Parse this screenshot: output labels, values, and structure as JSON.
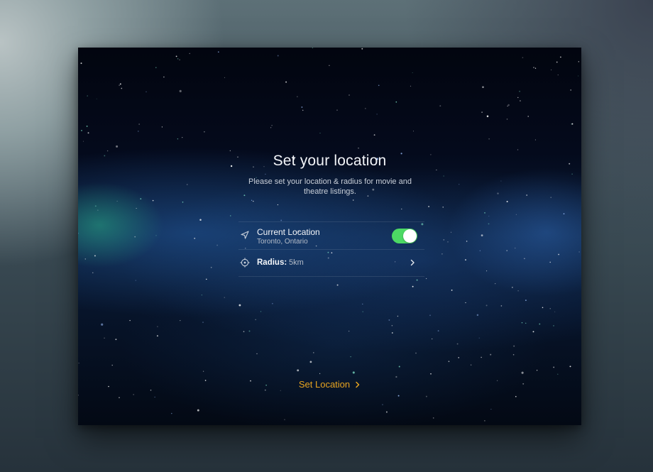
{
  "screen": {
    "title": "Set your location",
    "subtitle": "Please set your location & radius for movie and theatre listings."
  },
  "settings": {
    "current_location": {
      "icon": "location-arrow-icon",
      "label": "Current Location",
      "value": "Toronto, Ontario",
      "toggle_on": true
    },
    "radius": {
      "icon": "crosshair-icon",
      "label": "Radius:",
      "value": "5km"
    }
  },
  "actions": {
    "set_location": "Set Location"
  },
  "colors": {
    "accent": "#e7a41f",
    "toggle_on": "#4cd964"
  }
}
